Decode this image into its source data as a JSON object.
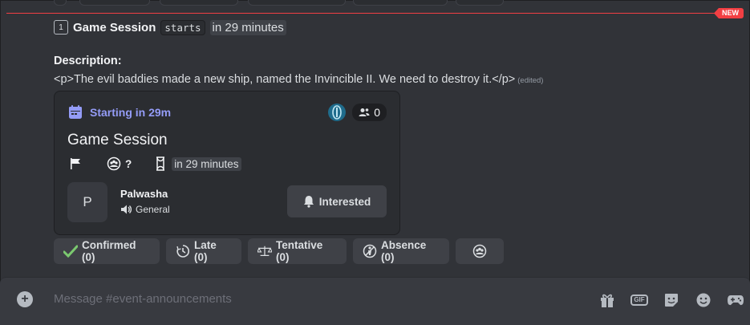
{
  "divider": {
    "badge": "NEW"
  },
  "headline": {
    "number_icon": "1",
    "title": "Game Session",
    "code": "starts",
    "relative_time": "in 29 minutes"
  },
  "description": {
    "label": "Description:",
    "text": "<p>The evil baddies made a new ship, named the Invincible II. We need to destroy it.</p>",
    "edited": "(edited)"
  },
  "event_card": {
    "starting": "Starting in 29m",
    "interested_count": "0",
    "title": "Game Session",
    "question_mark": "?",
    "relative_time": "in 29 minutes",
    "host_initial": "P",
    "host_name": "Palwasha",
    "channel": "General",
    "interested_button": "Interested"
  },
  "rsvp": [
    {
      "label": "Confirmed (0)",
      "icon": "check-icon"
    },
    {
      "label": "Late (0)",
      "icon": "late-clock-icon"
    },
    {
      "label": "Tentative (0)",
      "icon": "scales-icon"
    },
    {
      "label": "Absence (0)",
      "icon": "absence-icon"
    },
    {
      "label": "",
      "icon": "group-icon"
    }
  ],
  "composer": {
    "placeholder": "Message #event-announcements",
    "gif_label": "GIF"
  },
  "colors": {
    "background": "#313338",
    "accent": "#949cf7",
    "new_red": "#f23f43",
    "button": "#3f4147",
    "check_green": "#23a55a"
  }
}
